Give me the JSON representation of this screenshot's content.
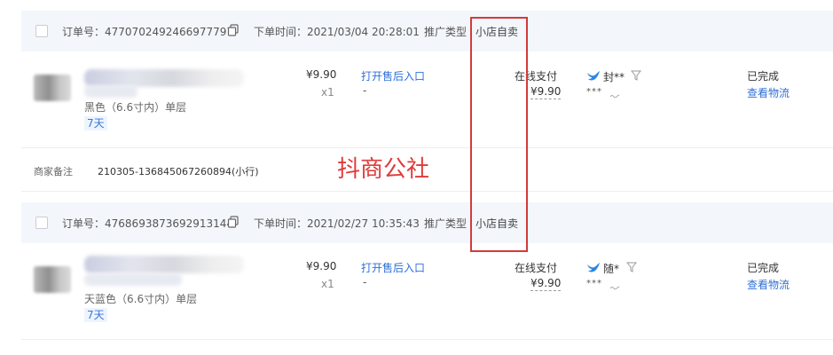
{
  "orders": [
    {
      "order_no_label": "订单号：",
      "order_no": "4770702492466977797",
      "time_label": "下单时间：",
      "time": "2021/03/04 20:28:01",
      "promo_label": "推广类型",
      "promo_value": "小店自卖",
      "sku": "黑色（6.6寸内）单层",
      "badge": "7天",
      "price": "¥9.90",
      "qty": "x1",
      "after_sale_link": "打开售后入口",
      "after_sale_value": "-",
      "pay_method": "在线支付",
      "pay_amount": "¥9.90",
      "buyer_name": "封**",
      "buyer_masked": "***",
      "status": "已完成",
      "logistics_link": "查看物流"
    },
    {
      "order_no_label": "订单号：",
      "order_no": "4768693873692913144",
      "time_label": "下单时间：",
      "time": "2021/02/27 10:35:43",
      "promo_label": "推广类型",
      "promo_value": "小店自卖",
      "sku": "天蓝色（6.6寸内）单层",
      "badge": "7天",
      "price": "¥9.90",
      "qty": "x1",
      "after_sale_link": "打开售后入口",
      "after_sale_value": "-",
      "pay_method": "在线支付",
      "pay_amount": "¥9.90",
      "buyer_name": "随*",
      "buyer_masked": "***",
      "status": "已完成",
      "logistics_link": "查看物流"
    }
  ],
  "remark": {
    "label": "商家备注",
    "value": "210305-136845067260894(小行)"
  },
  "watermark": "抖商公社",
  "colors": {
    "link": "#2e6fd8",
    "header_bg": "#f3f6fb",
    "highlight": "#d43a3a"
  },
  "icons": [
    "copy-icon",
    "bird-icon",
    "filter-icon"
  ]
}
